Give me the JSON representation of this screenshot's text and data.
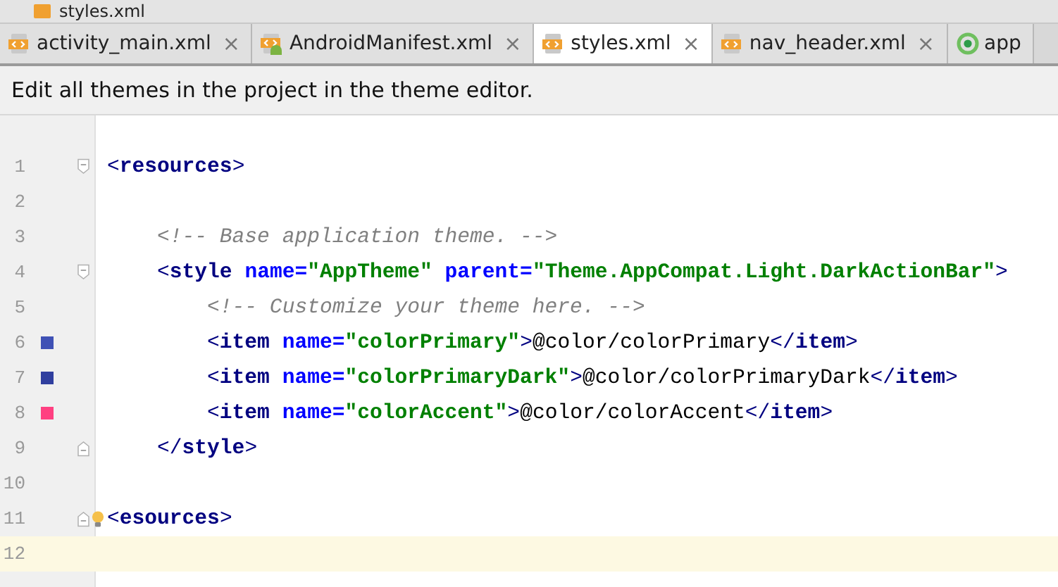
{
  "breadcrumb": {
    "label": "styles.xml"
  },
  "tabs": [
    {
      "label": "activity_main.xml",
      "kind": "xml",
      "selected": false,
      "closable": true
    },
    {
      "label": "AndroidManifest.xml",
      "kind": "manifest",
      "selected": false,
      "closable": true
    },
    {
      "label": "styles.xml",
      "kind": "xml",
      "selected": true,
      "closable": true
    },
    {
      "label": "nav_header.xml",
      "kind": "xml",
      "selected": false,
      "closable": true
    },
    {
      "label": "app",
      "kind": "module",
      "selected": false,
      "closable": false
    }
  ],
  "close_glyph": "×",
  "notice": {
    "text": "Edit all themes in the project in the theme editor."
  },
  "editor": {
    "lines": [
      {
        "number": "1",
        "fold_start": true,
        "fold_end": false,
        "bulb": false,
        "current": false,
        "tokens": [
          {
            "kind": "bracket",
            "text": "<"
          },
          {
            "kind": "tag",
            "text": "resources"
          },
          {
            "kind": "bracket",
            "text": ">"
          }
        ]
      },
      {
        "number": "2",
        "fold_start": false,
        "fold_end": false,
        "bulb": false,
        "current": false
      },
      {
        "number": "3",
        "fold_start": false,
        "fold_end": false,
        "bulb": false,
        "current": false,
        "tokens": [
          {
            "kind": "comment",
            "text": "    <!-- Base application theme. -->"
          }
        ]
      },
      {
        "number": "4",
        "fold_start": true,
        "fold_end": false,
        "bulb": false,
        "current": false,
        "tokens": [
          {
            "kind": "bracket",
            "text": "    <"
          },
          {
            "kind": "tag",
            "text": "style "
          },
          {
            "kind": "attr",
            "text": "name="
          },
          {
            "kind": "value",
            "text": "\"AppTheme\""
          },
          {
            "kind": "attr",
            "text": " parent="
          },
          {
            "kind": "value",
            "text": "\"Theme.AppCompat.Light.DarkActionBar\""
          },
          {
            "kind": "bracket",
            "text": ">"
          }
        ]
      },
      {
        "number": "5",
        "fold_start": false,
        "fold_end": false,
        "bulb": false,
        "current": false,
        "tokens": [
          {
            "kind": "comment",
            "text": "        <!-- Customize your theme here. -->"
          }
        ]
      },
      {
        "number": "6",
        "color": "#3f51b5",
        "fold_start": false,
        "fold_end": false,
        "bulb": false,
        "current": false,
        "tokens": [
          {
            "kind": "bracket",
            "text": "        <"
          },
          {
            "kind": "tag",
            "text": "item "
          },
          {
            "kind": "attr",
            "text": "name="
          },
          {
            "kind": "value",
            "text": "\"colorPrimary\""
          },
          {
            "kind": "bracket",
            "text": ">"
          },
          {
            "kind": "text",
            "text": "@color/colorPrimary"
          },
          {
            "kind": "bracket",
            "text": "</"
          },
          {
            "kind": "tag",
            "text": "item"
          },
          {
            "kind": "bracket",
            "text": ">"
          }
        ]
      },
      {
        "number": "7",
        "color": "#303f9f",
        "fold_start": false,
        "fold_end": false,
        "bulb": false,
        "current": false,
        "tokens": [
          {
            "kind": "bracket",
            "text": "        <"
          },
          {
            "kind": "tag",
            "text": "item "
          },
          {
            "kind": "attr",
            "text": "name="
          },
          {
            "kind": "value",
            "text": "\"colorPrimaryDark\""
          },
          {
            "kind": "bracket",
            "text": ">"
          },
          {
            "kind": "text",
            "text": "@color/colorPrimaryDark"
          },
          {
            "kind": "bracket",
            "text": "</"
          },
          {
            "kind": "tag",
            "text": "item"
          },
          {
            "kind": "bracket",
            "text": ">"
          }
        ]
      },
      {
        "number": "8",
        "color": "#ff4081",
        "fold_start": false,
        "fold_end": false,
        "bulb": false,
        "current": false,
        "tokens": [
          {
            "kind": "bracket",
            "text": "        <"
          },
          {
            "kind": "tag",
            "text": "item "
          },
          {
            "kind": "attr",
            "text": "name="
          },
          {
            "kind": "value",
            "text": "\"colorAccent\""
          },
          {
            "kind": "bracket",
            "text": ">"
          },
          {
            "kind": "text",
            "text": "@color/colorAccent"
          },
          {
            "kind": "bracket",
            "text": "</"
          },
          {
            "kind": "tag",
            "text": "item"
          },
          {
            "kind": "bracket",
            "text": ">"
          }
        ]
      },
      {
        "number": "9",
        "fold_start": false,
        "fold_end": true,
        "bulb": false,
        "current": false,
        "tokens": [
          {
            "kind": "bracket",
            "text": "    </"
          },
          {
            "kind": "tag",
            "text": "style"
          },
          {
            "kind": "bracket",
            "text": ">"
          }
        ]
      },
      {
        "number": "10",
        "fold_start": false,
        "fold_end": false,
        "bulb": false,
        "current": false
      },
      {
        "number": "11",
        "fold_start": false,
        "fold_end": true,
        "bulb": true,
        "current": false,
        "tokens": [
          {
            "kind": "bracket",
            "text": "<"
          },
          {
            "kind": "tag",
            "text": "esources"
          },
          {
            "kind": "bracket",
            "text": ">"
          }
        ]
      },
      {
        "number": "12",
        "fold_start": false,
        "fold_end": false,
        "bulb": false,
        "current": true
      }
    ]
  }
}
